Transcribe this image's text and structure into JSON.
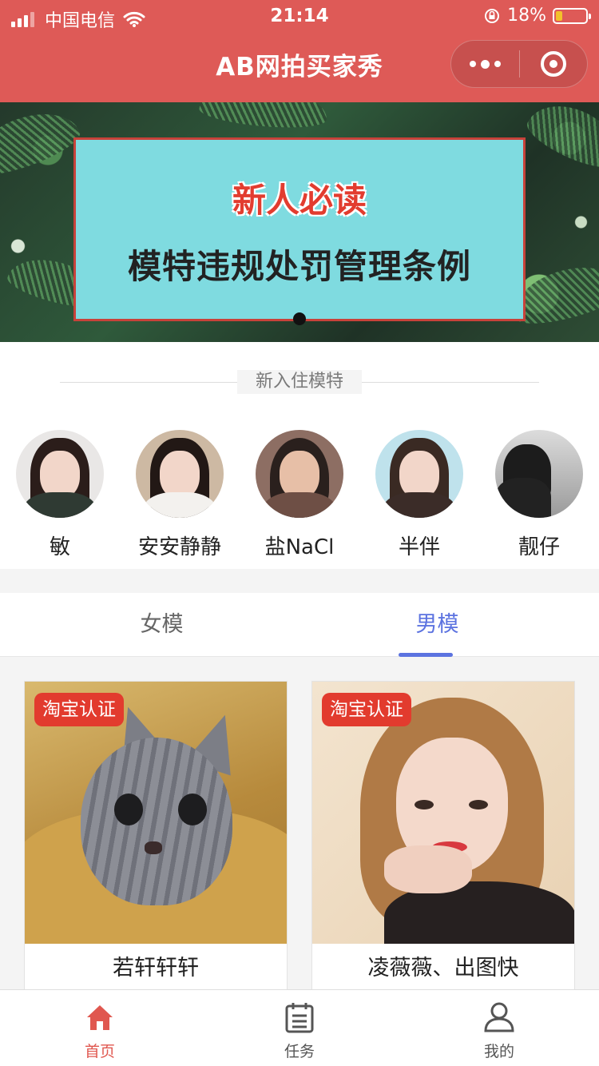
{
  "status_bar": {
    "carrier": "中国电信",
    "time": "21:14",
    "battery": "18%"
  },
  "header": {
    "title": "AB网拍买家秀"
  },
  "banner": {
    "subtitle": "新人必读",
    "title": "模特违规处罚管理条例"
  },
  "new_models": {
    "section_title": "新入住模特",
    "items": [
      {
        "name": "敏"
      },
      {
        "name": "安安静静"
      },
      {
        "name": "盐NaCl"
      },
      {
        "name": "半伴"
      },
      {
        "name": "靓仔"
      }
    ]
  },
  "tabs": [
    {
      "label": "女模",
      "active": false
    },
    {
      "label": "男模",
      "active": true
    }
  ],
  "cards": [
    {
      "badge": "淘宝认证",
      "name": "若轩轩轩"
    },
    {
      "badge": "淘宝认证",
      "name": "凌薇薇、出图快"
    }
  ],
  "bottom_nav": [
    {
      "label": "首页",
      "icon": "home-icon",
      "active": true
    },
    {
      "label": "任务",
      "icon": "task-icon",
      "active": false
    },
    {
      "label": "我的",
      "icon": "user-icon",
      "active": false
    }
  ],
  "colors": {
    "header": "#de5a57",
    "accent": "#5c73e0",
    "badge": "#e23b2e",
    "nav_active": "#e0574f"
  }
}
